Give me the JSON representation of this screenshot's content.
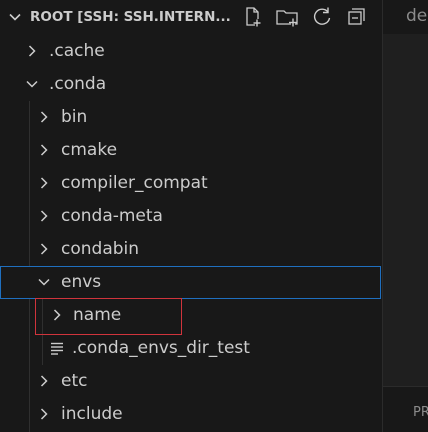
{
  "explorer": {
    "root_title": "ROOT [SSH: SSH.INTERN...",
    "actions": [
      {
        "name": "new-file-icon"
      },
      {
        "name": "new-folder-icon"
      },
      {
        "name": "refresh-icon"
      },
      {
        "name": "collapse-all-icon"
      }
    ],
    "items": [
      {
        "label": ".cache",
        "kind": "folder",
        "expanded": false,
        "level": 1
      },
      {
        "label": ".conda",
        "kind": "folder",
        "expanded": true,
        "level": 1
      },
      {
        "label": "bin",
        "kind": "folder",
        "expanded": false,
        "level": 2
      },
      {
        "label": "cmake",
        "kind": "folder",
        "expanded": false,
        "level": 2
      },
      {
        "label": "compiler_compat",
        "kind": "folder",
        "expanded": false,
        "level": 2
      },
      {
        "label": "conda-meta",
        "kind": "folder",
        "expanded": false,
        "level": 2
      },
      {
        "label": "condabin",
        "kind": "folder",
        "expanded": false,
        "level": 2
      },
      {
        "label": "envs",
        "kind": "folder",
        "expanded": true,
        "level": 2,
        "selected": true
      },
      {
        "label": "name",
        "kind": "folder",
        "expanded": false,
        "level": 3
      },
      {
        "label": ".conda_envs_dir_test",
        "kind": "file",
        "level": 3
      },
      {
        "label": "etc",
        "kind": "folder",
        "expanded": false,
        "level": 2
      },
      {
        "label": "include",
        "kind": "folder",
        "expanded": false,
        "level": 2
      }
    ]
  },
  "editor": {
    "tab_label": "de",
    "panel_label": "PR"
  },
  "colors": {
    "background": "#181818",
    "text": "#cccccc",
    "selection_border": "#1f6fbf",
    "highlight_box": "#d0343c"
  }
}
